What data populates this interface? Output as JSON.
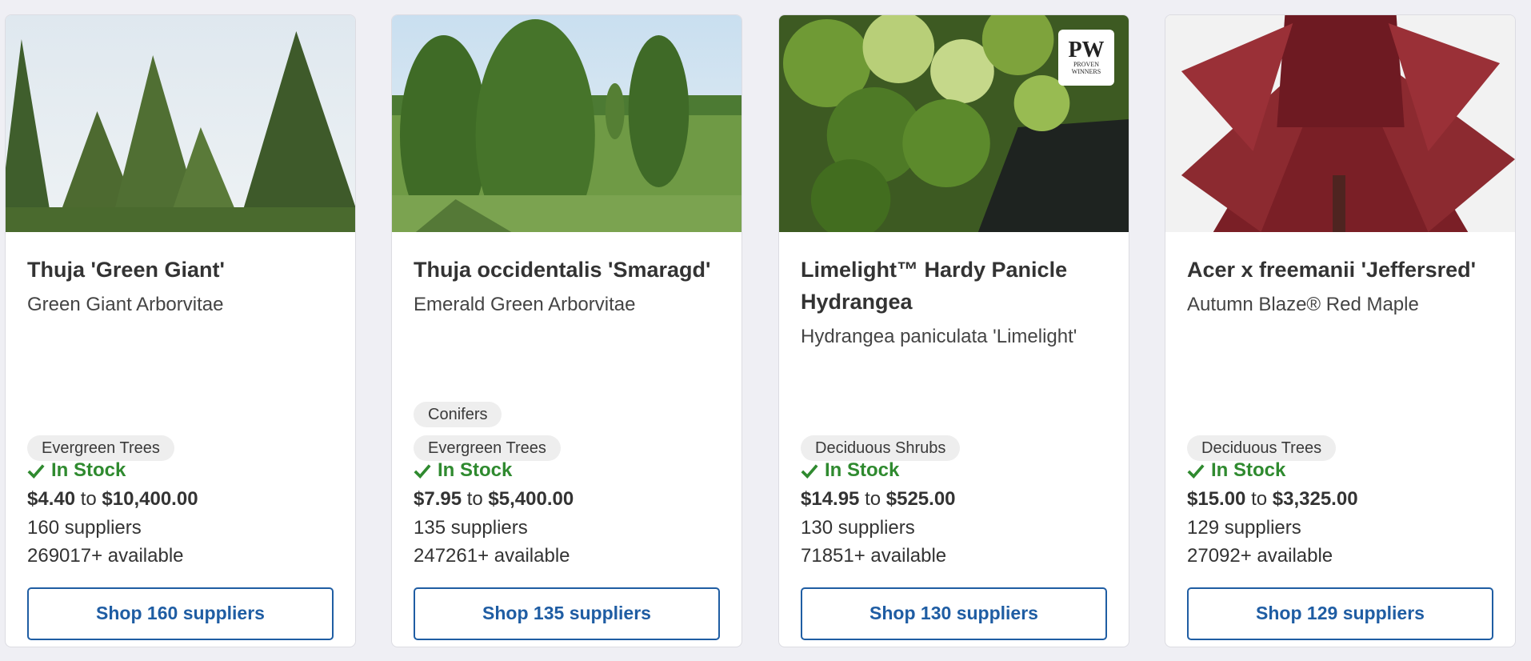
{
  "cards": [
    {
      "title": "Thuja 'Green Giant'",
      "subtitle": "Green Giant Arborvitae",
      "tags": [
        "Evergreen Trees"
      ],
      "stock": "In Stock",
      "price_from": "$4.40",
      "price_sep": "to",
      "price_to": "$10,400.00",
      "suppliers": "160 suppliers",
      "available": "269017+ available",
      "button": "Shop 160 suppliers"
    },
    {
      "title": "Thuja occidentalis 'Smaragd'",
      "subtitle": "Emerald Green Arborvitae",
      "tags": [
        "Conifers",
        "Evergreen Trees"
      ],
      "stock": "In Stock",
      "price_from": "$7.95",
      "price_sep": "to",
      "price_to": "$5,400.00",
      "suppliers": "135 suppliers",
      "available": "247261+ available",
      "button": "Shop 135 suppliers"
    },
    {
      "title": "Limelight™ Hardy Panicle Hydrangea",
      "subtitle": "Hydrangea paniculata 'Limelight'",
      "badge_main": "PW",
      "badge_sub": "PROVEN WINNERS",
      "tags": [
        "Deciduous Shrubs"
      ],
      "stock": "In Stock",
      "price_from": "$14.95",
      "price_sep": "to",
      "price_to": "$525.00",
      "suppliers": "130 suppliers",
      "available": "71851+ available",
      "button": "Shop 130 suppliers"
    },
    {
      "title": "Acer x freemanii 'Jeffersred'",
      "subtitle": "Autumn Blaze® Red Maple",
      "tags": [
        "Deciduous Trees"
      ],
      "stock": "In Stock",
      "price_from": "$15.00",
      "price_sep": "to",
      "price_to": "$3,325.00",
      "suppliers": "129 suppliers",
      "available": "27092+ available",
      "button": "Shop 129 suppliers"
    }
  ],
  "colors": {
    "accent": "#1f5da3",
    "stock_green": "#2f8a2f",
    "tag_bg": "#eeeeee",
    "page_bg": "#efeff4"
  },
  "icons": {
    "stock": "check-icon"
  }
}
